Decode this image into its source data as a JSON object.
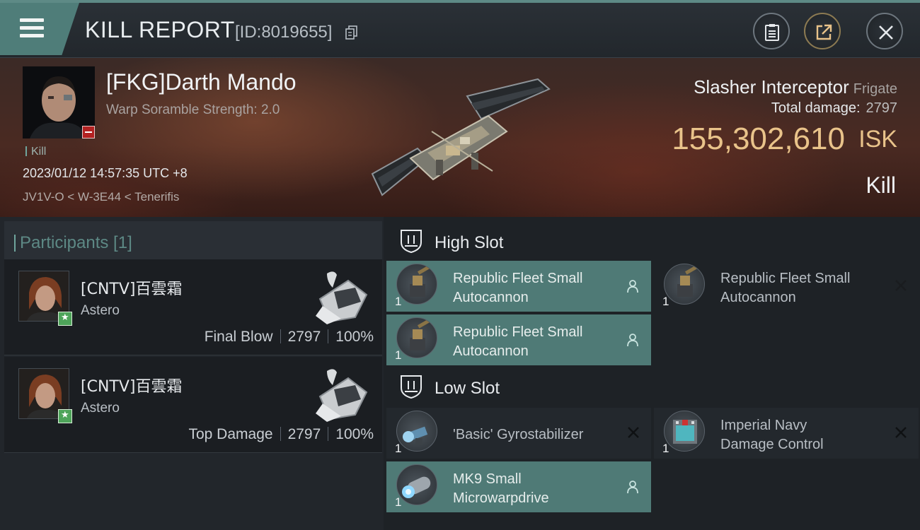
{
  "titlebar": {
    "title": "KILL REPORT",
    "report_id": "[ID:8019655]"
  },
  "victim": {
    "name": "[FKG]Darth Mando",
    "subtitle": "Warp Soramble Strength: 2.0",
    "tag": "Kill",
    "timestamp": "2023/01/12 14:57:35 UTC +8",
    "location": "JV1V-O < W-3E44 < Tenerifis"
  },
  "ship": {
    "name": "Slasher Interceptor",
    "class": "Frigate",
    "total_damage_label": "Total damage:",
    "total_damage_value": "2797",
    "isk_value": "155,302,610",
    "isk_unit": "ISK",
    "result": "Kill"
  },
  "participants": {
    "label": "Participants [1]",
    "rows": [
      {
        "name": "[CNTV]百雲霜",
        "ship": "Astero",
        "role": "Final Blow",
        "damage": "2797",
        "percent": "100%"
      },
      {
        "name": "[CNTV]百雲霜",
        "ship": "Astero",
        "role": "Top Damage",
        "damage": "2797",
        "percent": "100%"
      }
    ]
  },
  "slots": {
    "high": {
      "label": "High Slot",
      "items": [
        {
          "line1": "Republic Fleet Small",
          "line2": "Autocannon",
          "qty": "1",
          "status": "fitted"
        },
        {
          "line1": "Republic Fleet Small",
          "line2": "Autocannon",
          "qty": "1",
          "status": "destroyed"
        },
        {
          "line1": "Republic Fleet Small",
          "line2": "Autocannon",
          "qty": "1",
          "status": "fitted"
        }
      ]
    },
    "low": {
      "label": "Low Slot",
      "items": [
        {
          "line1": "'Basic' Gyrostabilizer",
          "line2": "",
          "qty": "1",
          "status": "destroyed"
        },
        {
          "line1": "Imperial Navy",
          "line2": "Damage Control",
          "qty": "1",
          "status": "destroyed"
        },
        {
          "line1": "MK9 Small",
          "line2": "Microwarpdrive",
          "qty": "1",
          "status": "fitted"
        }
      ]
    }
  },
  "colors": {
    "accent_teal": "#4f7a76",
    "isk_gold": "#e9c38a",
    "badge_red": "#b32222",
    "badge_green": "#4ea45a"
  },
  "icons": [
    "menu-icon",
    "copy-icon",
    "clipboard-icon",
    "share-icon",
    "close-icon",
    "shield-icon",
    "person-icon",
    "x-icon",
    "star-icon",
    "minus-icon"
  ]
}
